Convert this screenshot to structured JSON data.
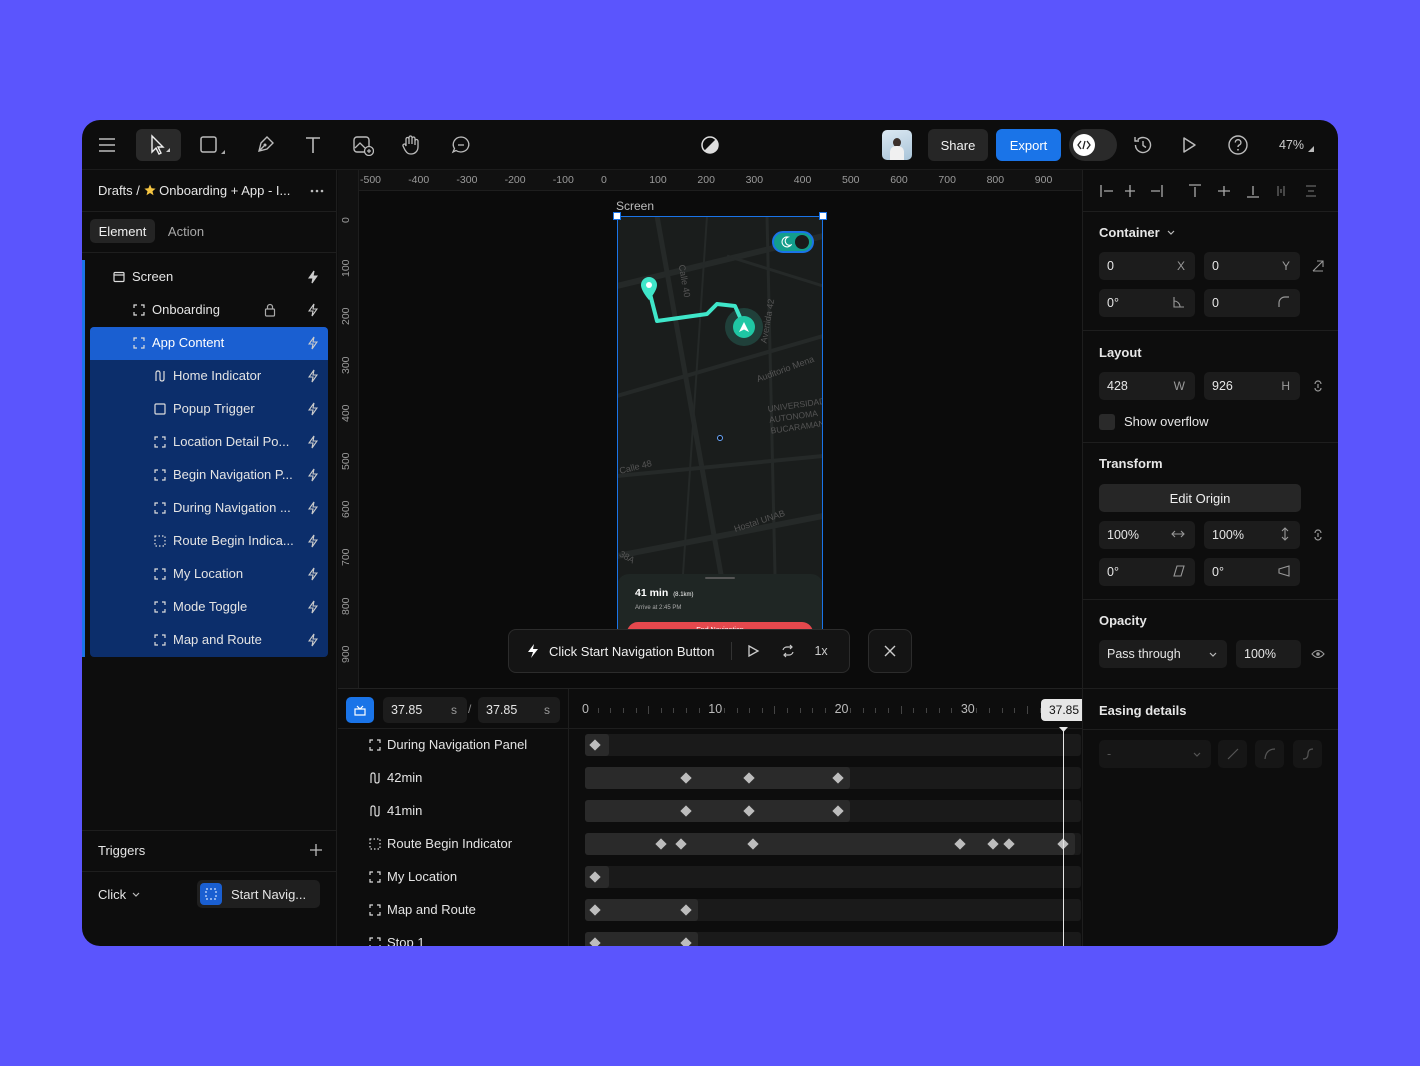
{
  "toolbar": {
    "tools": [
      "menu-icon",
      "pointer-icon",
      "shape-icon",
      "pen-icon",
      "text-icon",
      "image-icon",
      "hand-icon",
      "comment-icon"
    ],
    "share_label": "Share",
    "export_label": "Export",
    "zoom": "47%"
  },
  "breadcrumb": {
    "root": "Drafts",
    "separator": "/",
    "project": "Onboarding + App - I..."
  },
  "panel_tabs": [
    "Element",
    "Action"
  ],
  "layers": [
    {
      "name": "Screen",
      "icon": "frame-icon",
      "depth": 0
    },
    {
      "name": "Onboarding",
      "icon": "group-icon",
      "depth": 1,
      "locked": true
    },
    {
      "name": "App Content",
      "icon": "group-icon",
      "depth": 1,
      "selected": true
    },
    {
      "name": "Home Indicator",
      "icon": "path-icon",
      "depth": 2
    },
    {
      "name": "Popup Trigger",
      "icon": "rect-icon",
      "depth": 2
    },
    {
      "name": "Location Detail Po...",
      "icon": "group-icon",
      "depth": 2
    },
    {
      "name": "Begin Navigation P...",
      "icon": "group-icon",
      "depth": 2
    },
    {
      "name": "During Navigation ...",
      "icon": "group-icon",
      "depth": 2
    },
    {
      "name": "Route Begin Indica...",
      "icon": "dotted-icon",
      "depth": 2
    },
    {
      "name": "My Location",
      "icon": "group-icon",
      "depth": 2
    },
    {
      "name": "Mode Toggle",
      "icon": "group-icon",
      "depth": 2
    },
    {
      "name": "Map and Route",
      "icon": "group-icon",
      "depth": 2
    }
  ],
  "triggers": {
    "title": "Triggers",
    "event": "Click",
    "action": "Start Navig..."
  },
  "ruler": {
    "h": [
      "-500",
      "-400",
      "-300",
      "-200",
      "-100",
      "0",
      "100",
      "200",
      "300",
      "400",
      "500",
      "600",
      "700",
      "800",
      "900"
    ],
    "v": [
      "0",
      "100",
      "200",
      "300",
      "400",
      "500",
      "600",
      "700",
      "800",
      "900"
    ]
  },
  "canvas": {
    "frame_label": "Screen",
    "map": {
      "streets": [
        "Calle 40",
        "Avenida 42",
        "Auditorio Mena",
        "UNIVERSIDAD AUTONOMA BUCARAMANGA",
        "Hostal UNAB",
        "Calle 48",
        "38A"
      ],
      "eta": "41 min",
      "distance": "(8.1km)",
      "arrive": "Arrive at 2:45 PM",
      "end_button": "End Navigation"
    },
    "player": {
      "label": "Click Start Navigation Button",
      "speed": "1x"
    }
  },
  "timeline": {
    "current": "37.85",
    "duration": "37.85",
    "unit": "s",
    "sep": "/",
    "ticks": [
      "0",
      "10",
      "20",
      "30"
    ],
    "playhead": "37.85",
    "rows": [
      {
        "name": "During Navigation Panel",
        "icon": "group-icon",
        "keys": [
          0.8
        ]
      },
      {
        "name": "42min",
        "icon": "path-icon",
        "keys": [
          8,
          13,
          20
        ]
      },
      {
        "name": "41min",
        "icon": "path-icon",
        "keys": [
          8,
          13,
          20
        ]
      },
      {
        "name": "Route Begin Indicator",
        "icon": "dotted-icon",
        "keys": [
          6,
          7.6,
          13.3,
          29.7,
          32.3,
          33.6,
          37.85
        ]
      },
      {
        "name": "My Location",
        "icon": "group-icon",
        "keys": [
          0.8
        ]
      },
      {
        "name": "Map and Route",
        "icon": "group-icon",
        "keys": [
          0.8,
          8
        ]
      },
      {
        "name": "Stop 1",
        "icon": "group-icon",
        "keys": [
          0.8,
          8
        ]
      }
    ]
  },
  "inspector": {
    "container": {
      "title": "Container",
      "x": "0",
      "y": "0",
      "rotation": "0°",
      "radius": "0",
      "x_label": "X",
      "y_label": "Y"
    },
    "layout": {
      "title": "Layout",
      "w": "428",
      "h": "926",
      "w_label": "W",
      "h_label": "H",
      "overflow": "Show overflow"
    },
    "transform": {
      "title": "Transform",
      "edit_origin": "Edit Origin",
      "scale_x": "100%",
      "scale_y": "100%",
      "skew_x": "0°",
      "skew_y": "0°"
    },
    "opacity": {
      "title": "Opacity",
      "blend": "Pass through",
      "value": "100%"
    },
    "easing": {
      "title": "Easing details",
      "value": "-"
    }
  },
  "colors": {
    "accent": "#1a74e8",
    "selection_bg": "#1a5fd1",
    "selection_child_bg": "#0c2e6b",
    "route": "#3fe6c9",
    "end_button": "#e5484d"
  }
}
